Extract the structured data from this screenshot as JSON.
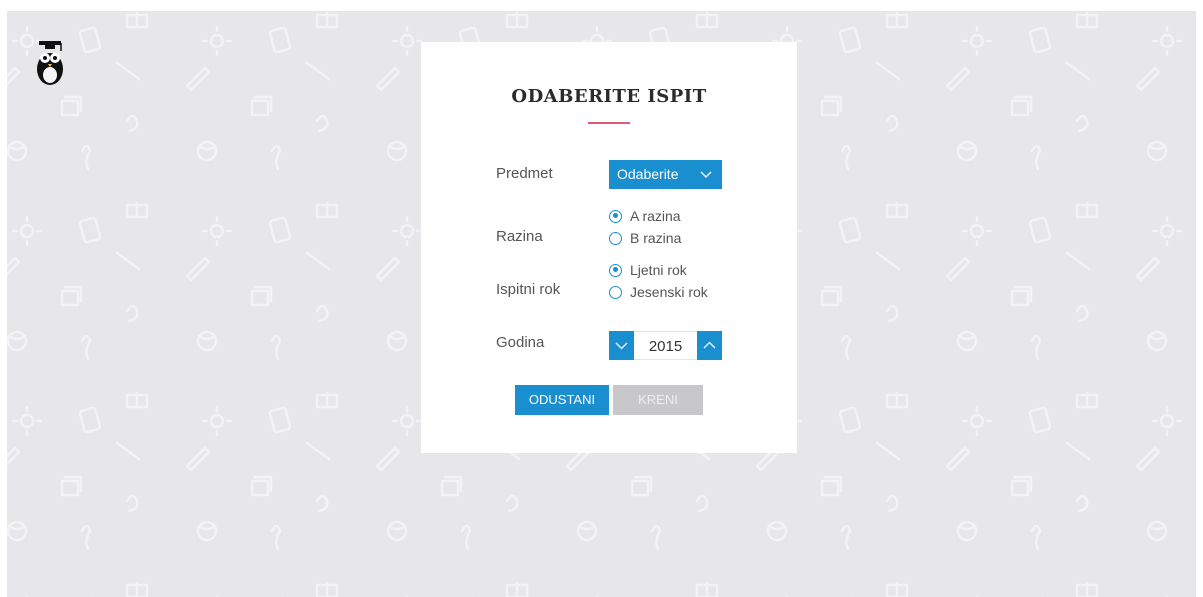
{
  "modal": {
    "title": "ODABERITE ISPIT"
  },
  "form": {
    "subject": {
      "label": "Predmet",
      "selected": "Odaberite"
    },
    "level": {
      "label": "Razina",
      "options": [
        {
          "label": "A razina",
          "checked": true
        },
        {
          "label": "B razina",
          "checked": false
        }
      ]
    },
    "term": {
      "label": "Ispitni rok",
      "options": [
        {
          "label": "Ljetni rok",
          "checked": true
        },
        {
          "label": "Jesenski rok",
          "checked": false
        }
      ]
    },
    "year": {
      "label": "Godina",
      "value": "2015"
    }
  },
  "actions": {
    "cancel_label": "ODUSTANI",
    "go_label": "KRENI"
  },
  "colors": {
    "accent": "#1a8fd0",
    "underline": "#e05a7a",
    "background": "#e7e7ea",
    "disabled": "#c8c8ca"
  },
  "icons": {
    "logo": "owl-graduate-icon",
    "select_arrow": "chevron-down-icon",
    "decrement": "chevron-down-icon",
    "increment": "chevron-up-icon"
  }
}
